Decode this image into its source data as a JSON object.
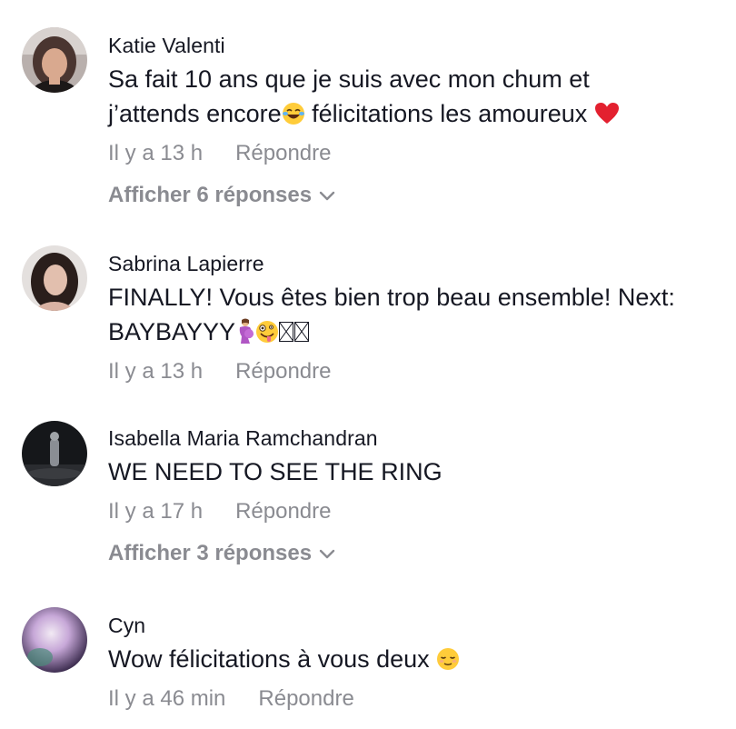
{
  "comments": [
    {
      "author": "Katie Valenti",
      "text_line1": "Sa fait 10 ans que je suis avec mon chum et",
      "text_line2a": "j’attends encore",
      "text_line2b": " félicitations les amoureux ",
      "time": "Il y a 13 h",
      "reply_label": "Répondre",
      "view_replies": "Afficher 6 réponses",
      "emojis": [
        "joy-emoji",
        "red-heart-emoji"
      ]
    },
    {
      "author": "Sabrina Lapierre",
      "text_line1": "FINALLY! Vous êtes bien trop beau ensemble! Next:",
      "text_line2": "BAYBAYYY",
      "time": "Il y a 13 h",
      "reply_label": "Répondre",
      "emojis": [
        "pregnant-woman-emoji",
        "zany-face-emoji",
        "missing-glyph",
        "missing-glyph"
      ]
    },
    {
      "author": "Isabella Maria Ramchandran",
      "text_line1": "WE NEED TO SEE THE RING",
      "time": "Il y a 17 h",
      "reply_label": "Répondre",
      "view_replies": "Afficher 3 réponses"
    },
    {
      "author": "Cyn",
      "text_line1": "Wow félicitations à vous deux ",
      "time": "Il y a 46 min",
      "reply_label": "Répondre",
      "emojis": [
        "relieved-face-emoji"
      ]
    }
  ],
  "colors": {
    "text": "#161823",
    "secondary": "#8a8b91",
    "background": "#ffffff"
  }
}
